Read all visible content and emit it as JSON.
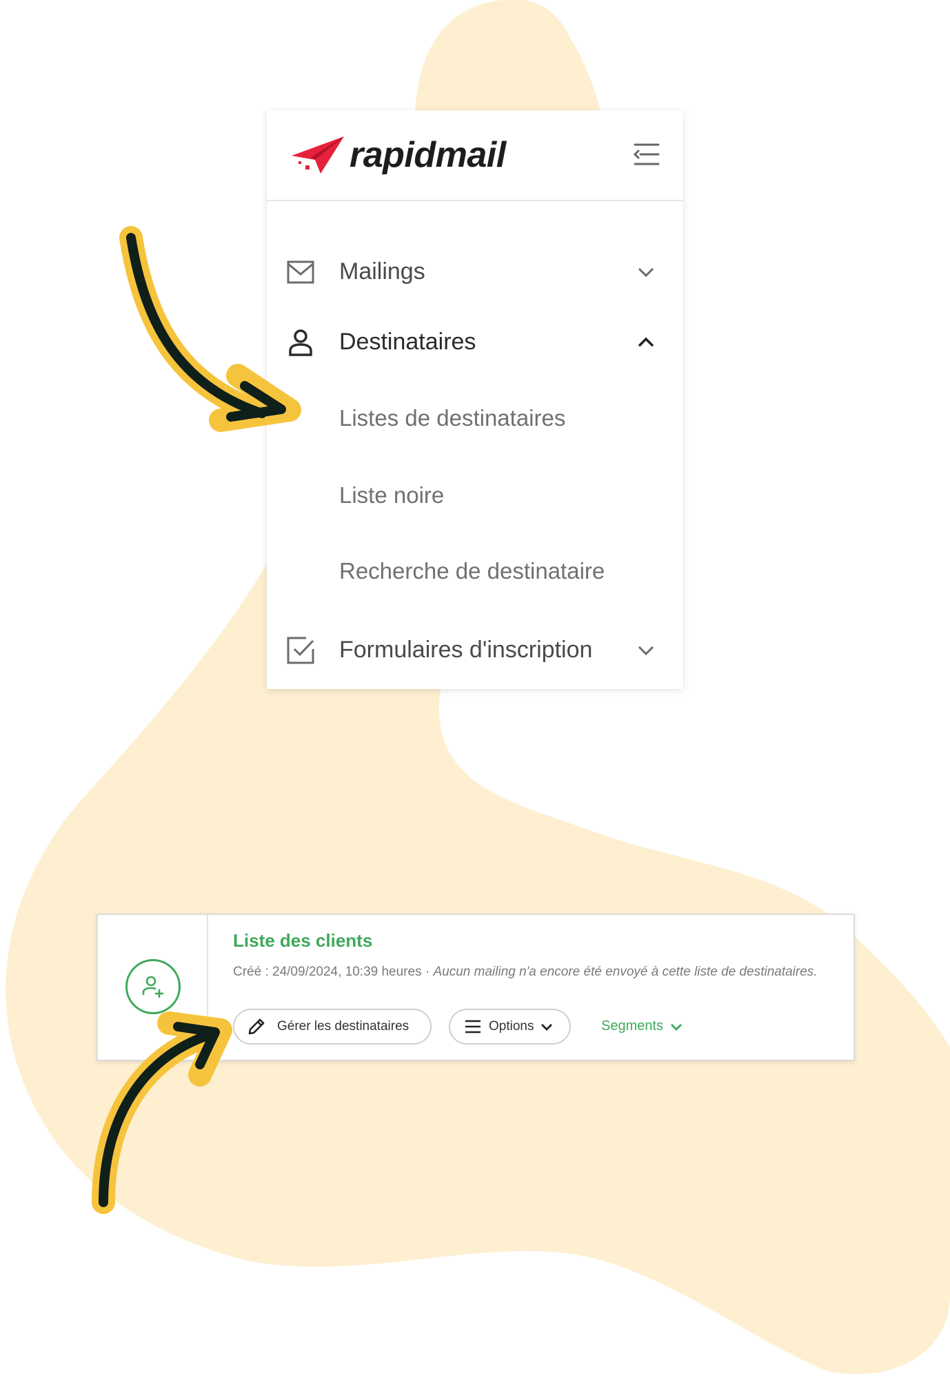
{
  "colors": {
    "blob": "#fdefd0",
    "accent_green": "#3ea95b",
    "logo_red": "#e8213a",
    "arrow_yellow": "#f6c33c",
    "arrow_dark": "#0f1f1a"
  },
  "logo": {
    "text": "rapidmail",
    "icon": "paper-plane-icon"
  },
  "header": {
    "collapse_icon": "collapse-menu-icon"
  },
  "menu": {
    "items": [
      {
        "label": "Mailings",
        "icon": "envelope-icon",
        "chevron": "chevron-down-icon",
        "expanded": false
      },
      {
        "label": "Destinataires",
        "icon": "user-icon",
        "chevron": "chevron-up-icon",
        "expanded": true,
        "subitems": [
          {
            "label": "Listes de destinataires"
          },
          {
            "label": "Liste noire"
          },
          {
            "label": "Recherche de destinataire"
          }
        ]
      },
      {
        "label": "Formulaires d'inscription",
        "icon": "checkbox-icon",
        "chevron": "chevron-down-icon",
        "expanded": false
      }
    ]
  },
  "list_card": {
    "avatar_icon": "user-plus-icon",
    "title": "Liste des clients",
    "created": "Créé : 24/09/2024, 10:39 heures",
    "separator": " · ",
    "note": "Aucun mailing n'a encore été envoyé à cette liste de destinataires.",
    "manage_button": {
      "label": "Gérer les destinataires",
      "icon": "pencil-icon"
    },
    "options_button": {
      "label": "Options",
      "icon": "hamburger-icon",
      "chevron": "chevron-down-icon"
    },
    "segments_link": {
      "label": "Segments",
      "chevron": "chevron-down-icon"
    }
  }
}
